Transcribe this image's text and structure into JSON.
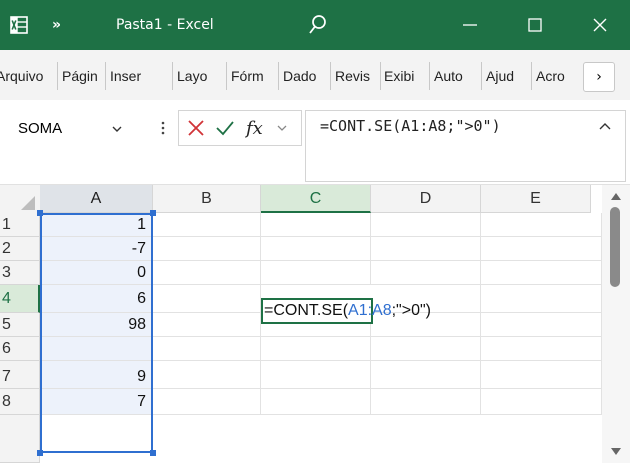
{
  "titlebar": {
    "title": "Pasta1  -  Excel",
    "more": "»",
    "icons": [
      "excel-logo-icon",
      "search-icon",
      "minimize-icon",
      "maximize-icon",
      "close-icon"
    ]
  },
  "ribbon": {
    "tabs": [
      "Arquivo",
      "Págin",
      "Inser",
      "Layo",
      "Fórm",
      "Dado",
      "Revis",
      "Exibi",
      "Auto",
      "Ajud",
      "Acro"
    ],
    "more": "›"
  },
  "formula_bar": {
    "name_box": "SOMA",
    "formula": "=CONT.SE(A1:A8;\">0\")"
  },
  "sheet": {
    "columns": [
      "A",
      "B",
      "C",
      "D",
      "E"
    ],
    "rows": [
      "1",
      "2",
      "3",
      "4",
      "5",
      "6",
      "7",
      "8"
    ],
    "col_a_values": [
      "1",
      "-7",
      "0",
      "6",
      "98",
      "",
      "9",
      "7"
    ],
    "edit": {
      "prefix": "=CONT.SE(",
      "ref": "A1:A8",
      "suffix": ";\">0\")"
    }
  },
  "colors": {
    "title_bg": "#1e7145",
    "range_highlight": "#2f6fd0",
    "cancel_x": "#d13438",
    "enter_check": "#1e7145"
  }
}
